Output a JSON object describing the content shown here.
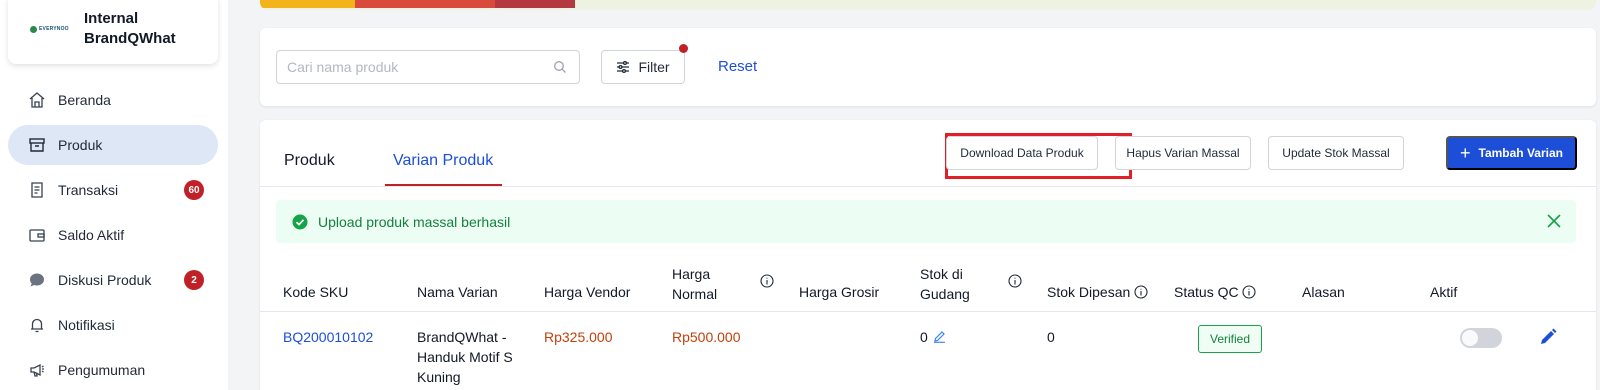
{
  "brand": {
    "logo_text": "EVERYNOO",
    "name_line1": "Internal",
    "name_line2": "BrandQWhat"
  },
  "sidebar": {
    "items": [
      {
        "label": "Beranda",
        "icon": "home-icon"
      },
      {
        "label": "Produk",
        "icon": "box-icon",
        "active": true
      },
      {
        "label": "Transaksi",
        "icon": "receipt-icon",
        "badge": "60"
      },
      {
        "label": "Saldo Aktif",
        "icon": "wallet-icon"
      },
      {
        "label": "Diskusi Produk",
        "icon": "chat-icon",
        "badge": "2"
      },
      {
        "label": "Notifikasi",
        "icon": "bell-icon"
      },
      {
        "label": "Pengumuman",
        "icon": "megaphone-icon"
      }
    ]
  },
  "filter": {
    "search_placeholder": "Cari nama produk",
    "filter_label": "Filter",
    "reset_label": "Reset"
  },
  "tabs": [
    {
      "label": "Produk"
    },
    {
      "label": "Varian Produk",
      "active": true
    }
  ],
  "actions": {
    "download": "Download Data Produk",
    "bulk_delete": "Hapus Varian Massal",
    "bulk_stock": "Update Stok Massal",
    "add_variant": "Tambah Varian"
  },
  "alert": {
    "text": "Upload produk massal berhasil"
  },
  "table": {
    "headers": {
      "sku": "Kode SKU",
      "variant_name": "Nama Varian",
      "vendor_price": "Harga Vendor",
      "normal_price_1": "Harga",
      "normal_price_2": "Normal",
      "wholesale_price": "Harga Grosir",
      "warehouse_stock_1": "Stok di",
      "warehouse_stock_2": "Gudang",
      "ordered_stock": "Stok Dipesan",
      "qc_status": "Status QC",
      "reason": "Alasan",
      "active": "Aktif"
    },
    "rows": [
      {
        "sku": "BQ200010102",
        "name_line1": "BrandQWhat -",
        "name_line2": "Handuk Motif S",
        "name_line3": "Kuning",
        "vendor_price": "Rp325.000",
        "normal_price": "Rp500.000",
        "wholesale_price": "",
        "warehouse_stock": "0",
        "ordered_stock": "0",
        "qc_status": "Verified",
        "reason": "",
        "active": false
      }
    ]
  },
  "colors": {
    "primary": "#1d4ed8",
    "danger": "#c02027",
    "success": "#15803d",
    "price": "#c2410c"
  }
}
